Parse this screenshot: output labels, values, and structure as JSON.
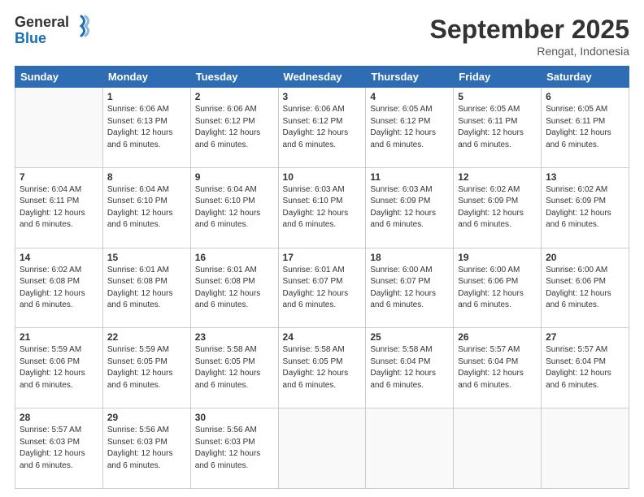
{
  "header": {
    "logo_general": "General",
    "logo_blue": "Blue",
    "month_title": "September 2025",
    "location": "Rengat, Indonesia"
  },
  "weekdays": [
    "Sunday",
    "Monday",
    "Tuesday",
    "Wednesday",
    "Thursday",
    "Friday",
    "Saturday"
  ],
  "weeks": [
    [
      {
        "day": "",
        "info": ""
      },
      {
        "day": "1",
        "info": "Sunrise: 6:06 AM\nSunset: 6:13 PM\nDaylight: 12 hours\nand 6 minutes."
      },
      {
        "day": "2",
        "info": "Sunrise: 6:06 AM\nSunset: 6:12 PM\nDaylight: 12 hours\nand 6 minutes."
      },
      {
        "day": "3",
        "info": "Sunrise: 6:06 AM\nSunset: 6:12 PM\nDaylight: 12 hours\nand 6 minutes."
      },
      {
        "day": "4",
        "info": "Sunrise: 6:05 AM\nSunset: 6:12 PM\nDaylight: 12 hours\nand 6 minutes."
      },
      {
        "day": "5",
        "info": "Sunrise: 6:05 AM\nSunset: 6:11 PM\nDaylight: 12 hours\nand 6 minutes."
      },
      {
        "day": "6",
        "info": "Sunrise: 6:05 AM\nSunset: 6:11 PM\nDaylight: 12 hours\nand 6 minutes."
      }
    ],
    [
      {
        "day": "7",
        "info": "Sunrise: 6:04 AM\nSunset: 6:11 PM\nDaylight: 12 hours\nand 6 minutes."
      },
      {
        "day": "8",
        "info": "Sunrise: 6:04 AM\nSunset: 6:10 PM\nDaylight: 12 hours\nand 6 minutes."
      },
      {
        "day": "9",
        "info": "Sunrise: 6:04 AM\nSunset: 6:10 PM\nDaylight: 12 hours\nand 6 minutes."
      },
      {
        "day": "10",
        "info": "Sunrise: 6:03 AM\nSunset: 6:10 PM\nDaylight: 12 hours\nand 6 minutes."
      },
      {
        "day": "11",
        "info": "Sunrise: 6:03 AM\nSunset: 6:09 PM\nDaylight: 12 hours\nand 6 minutes."
      },
      {
        "day": "12",
        "info": "Sunrise: 6:02 AM\nSunset: 6:09 PM\nDaylight: 12 hours\nand 6 minutes."
      },
      {
        "day": "13",
        "info": "Sunrise: 6:02 AM\nSunset: 6:09 PM\nDaylight: 12 hours\nand 6 minutes."
      }
    ],
    [
      {
        "day": "14",
        "info": "Sunrise: 6:02 AM\nSunset: 6:08 PM\nDaylight: 12 hours\nand 6 minutes."
      },
      {
        "day": "15",
        "info": "Sunrise: 6:01 AM\nSunset: 6:08 PM\nDaylight: 12 hours\nand 6 minutes."
      },
      {
        "day": "16",
        "info": "Sunrise: 6:01 AM\nSunset: 6:08 PM\nDaylight: 12 hours\nand 6 minutes."
      },
      {
        "day": "17",
        "info": "Sunrise: 6:01 AM\nSunset: 6:07 PM\nDaylight: 12 hours\nand 6 minutes."
      },
      {
        "day": "18",
        "info": "Sunrise: 6:00 AM\nSunset: 6:07 PM\nDaylight: 12 hours\nand 6 minutes."
      },
      {
        "day": "19",
        "info": "Sunrise: 6:00 AM\nSunset: 6:06 PM\nDaylight: 12 hours\nand 6 minutes."
      },
      {
        "day": "20",
        "info": "Sunrise: 6:00 AM\nSunset: 6:06 PM\nDaylight: 12 hours\nand 6 minutes."
      }
    ],
    [
      {
        "day": "21",
        "info": "Sunrise: 5:59 AM\nSunset: 6:06 PM\nDaylight: 12 hours\nand 6 minutes."
      },
      {
        "day": "22",
        "info": "Sunrise: 5:59 AM\nSunset: 6:05 PM\nDaylight: 12 hours\nand 6 minutes."
      },
      {
        "day": "23",
        "info": "Sunrise: 5:58 AM\nSunset: 6:05 PM\nDaylight: 12 hours\nand 6 minutes."
      },
      {
        "day": "24",
        "info": "Sunrise: 5:58 AM\nSunset: 6:05 PM\nDaylight: 12 hours\nand 6 minutes."
      },
      {
        "day": "25",
        "info": "Sunrise: 5:58 AM\nSunset: 6:04 PM\nDaylight: 12 hours\nand 6 minutes."
      },
      {
        "day": "26",
        "info": "Sunrise: 5:57 AM\nSunset: 6:04 PM\nDaylight: 12 hours\nand 6 minutes."
      },
      {
        "day": "27",
        "info": "Sunrise: 5:57 AM\nSunset: 6:04 PM\nDaylight: 12 hours\nand 6 minutes."
      }
    ],
    [
      {
        "day": "28",
        "info": "Sunrise: 5:57 AM\nSunset: 6:03 PM\nDaylight: 12 hours\nand 6 minutes."
      },
      {
        "day": "29",
        "info": "Sunrise: 5:56 AM\nSunset: 6:03 PM\nDaylight: 12 hours\nand 6 minutes."
      },
      {
        "day": "30",
        "info": "Sunrise: 5:56 AM\nSunset: 6:03 PM\nDaylight: 12 hours\nand 6 minutes."
      },
      {
        "day": "",
        "info": ""
      },
      {
        "day": "",
        "info": ""
      },
      {
        "day": "",
        "info": ""
      },
      {
        "day": "",
        "info": ""
      }
    ]
  ]
}
